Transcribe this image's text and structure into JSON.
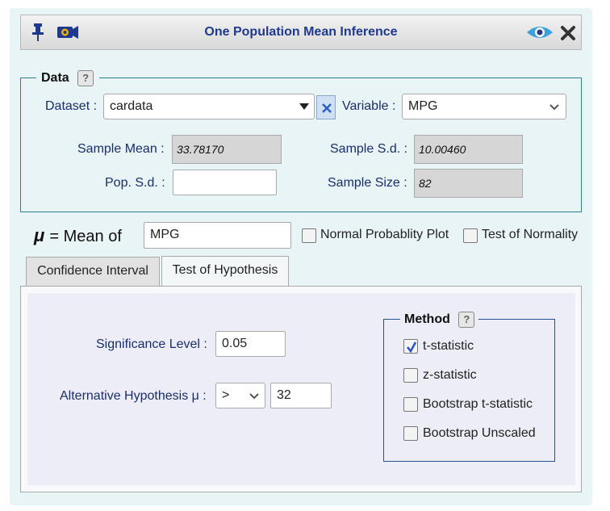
{
  "window": {
    "title": "One Population Mean Inference",
    "icons": {
      "pin": "pin-icon",
      "camera": "camera-icon",
      "eye": "eye-icon",
      "close": "close-icon"
    }
  },
  "data_section": {
    "legend": "Data",
    "help": "?",
    "dataset_label": "Dataset :",
    "dataset_value": "cardata",
    "variable_label": "Variable :",
    "variable_value": "MPG",
    "sample_mean_label": "Sample Mean :",
    "sample_mean_value": "33.78170",
    "sample_sd_label": "Sample S.d. :",
    "sample_sd_value": "10.00460",
    "pop_sd_label": "Pop. S.d. :",
    "pop_sd_value": "",
    "sample_size_label": "Sample Size :",
    "sample_size_value": "82"
  },
  "mean_row": {
    "mu_symbol": "μ",
    "mean_of_label": "= Mean of",
    "mean_of_value": "MPG",
    "normal_plot_label": "Normal Probablity Plot",
    "normal_plot_checked": false,
    "normality_test_label": "Test of Normality",
    "normality_test_checked": false
  },
  "tabs": [
    {
      "label": "Confidence Interval",
      "active": false
    },
    {
      "label": "Test of Hypothesis",
      "active": true
    }
  ],
  "hypothesis": {
    "significance_label": "Significance Level :",
    "significance_value": "0.05",
    "alternative_label": "Alternative Hypothesis μ :",
    "alternative_operator": ">",
    "alternative_value": "32"
  },
  "method": {
    "legend": "Method",
    "help": "?",
    "options": [
      {
        "label": "t-statistic",
        "checked": true
      },
      {
        "label": "z-statistic",
        "checked": false
      },
      {
        "label": "Bootstrap t-statistic",
        "checked": false
      },
      {
        "label": "Bootstrap Unscaled",
        "checked": false
      }
    ]
  },
  "colors": {
    "panel_bg": "#e8f4f6",
    "title_text": "#1f3a8c",
    "label_text": "#1a2e6e",
    "fieldset_border": "#2a7f8f",
    "check_mark": "#2b4fc7"
  }
}
